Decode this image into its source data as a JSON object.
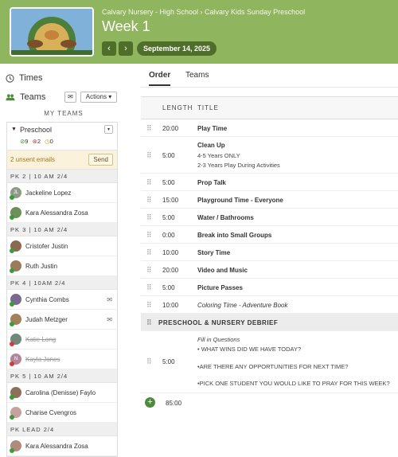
{
  "header": {
    "breadcrumb": "Calvary Nursery - High School › Calvary Kids Sunday Preschool",
    "title": "Week 1",
    "prev_icon": "‹",
    "next_icon": "›",
    "date": "September 14, 2025"
  },
  "sidebar": {
    "times_label": "Times",
    "teams_label": "Teams",
    "actions_label": "Actions",
    "my_teams_label": "MY TEAMS",
    "team": {
      "name": "Preschool",
      "stats": {
        "confirmed": "9",
        "declined": "2",
        "pending": "0"
      }
    },
    "unsent": {
      "text": "2 unsent emails",
      "send_label": "Send"
    },
    "groups": [
      {
        "label": "PK 2 | 10 AM 2/4",
        "people": [
          {
            "name": "Jackeline Lopez",
            "initials": "JL",
            "mail": false,
            "struck": false
          },
          {
            "name": "Kara Alessandra Zosa",
            "initials": "",
            "mail": false,
            "struck": false
          }
        ]
      },
      {
        "label": "PK 3 | 10 AM 2/4",
        "people": [
          {
            "name": "Cristofer Justin",
            "initials": "",
            "mail": false,
            "struck": false
          },
          {
            "name": "Ruth Justin",
            "initials": "",
            "mail": false,
            "struck": false
          }
        ]
      },
      {
        "label": "PK 4 | 10AM 2/4",
        "people": [
          {
            "name": "Cynthia Combs",
            "initials": "",
            "mail": true,
            "struck": false
          },
          {
            "name": "Judah Metzger",
            "initials": "",
            "mail": true,
            "struck": false
          },
          {
            "name": "Katie Long",
            "initials": "",
            "mail": false,
            "struck": true
          },
          {
            "name": "Kayla Jones",
            "initials": "N",
            "mail": false,
            "struck": true
          }
        ]
      },
      {
        "label": "PK 5 | 10 AM 2/4",
        "people": [
          {
            "name": "Carolina (Denisse) Faylo",
            "initials": "",
            "mail": false,
            "struck": false
          },
          {
            "name": "Charise Cvengros",
            "initials": "",
            "mail": false,
            "struck": false
          }
        ]
      },
      {
        "label": "PK LEAD 2/4",
        "people": [
          {
            "name": "Kara Alessandra Zosa",
            "initials": "",
            "mail": false,
            "struck": false
          }
        ]
      }
    ]
  },
  "tabs": [
    {
      "label": "Order",
      "active": true
    },
    {
      "label": "Teams",
      "active": false
    }
  ],
  "table": {
    "headers": {
      "length": "LENGTH",
      "title": "TITLE"
    },
    "rows": [
      {
        "length": "20:00",
        "title": "Play Time"
      },
      {
        "length": "5:00",
        "title": "Clean Up",
        "notes": [
          "4-5 Years ONLY",
          "2-3 Years Play During Activities"
        ]
      },
      {
        "length": "5:00",
        "title": "Prop Talk"
      },
      {
        "length": "15:00",
        "title": "Playground Time - Everyone"
      },
      {
        "length": "5:00",
        "title": "Water / Bathrooms"
      },
      {
        "length": "0:00",
        "title": "Break into Small Groups"
      },
      {
        "length": "10:00",
        "title": "Story Time"
      },
      {
        "length": "20:00",
        "title": "Video and Music"
      },
      {
        "length": "5:00",
        "title": "Picture Passes"
      },
      {
        "length": "10:00",
        "title": "Coloring Time - Adventure Book",
        "italic": true
      }
    ],
    "section": "PRESCHOOL & NURSERY DEBRIEF",
    "debrief": {
      "length": "5:00",
      "title": "Fill in Questions",
      "lines": [
        "• WHAT WINS DID WE HAVE TODAY?",
        "•ARE THERE ANY OPPORTUNITIES FOR NEXT TIME?",
        "•PICK ONE STUDENT YOU WOULD LIKE TO PRAY FOR THIS WEEK?"
      ]
    },
    "total": "85:00"
  },
  "colors": {
    "accent": "#8fb55e",
    "dark_green": "#4f6e2a"
  }
}
